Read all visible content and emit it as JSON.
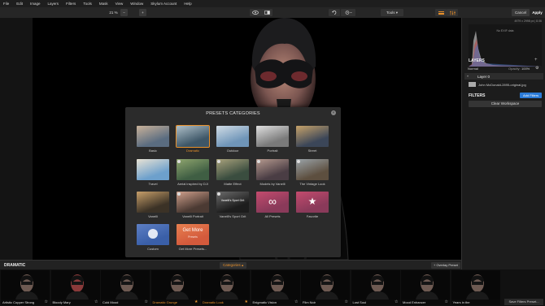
{
  "menu": [
    "File",
    "Edit",
    "Image",
    "Layers",
    "Filters",
    "Tools",
    "Mask",
    "View",
    "Window",
    "Skylum Account",
    "Help"
  ],
  "toolbar": {
    "zoom": "21 %",
    "minus": "−",
    "plus": "+",
    "tools": "Tools ▾",
    "cancel": "Cancel",
    "apply": "Apply"
  },
  "histogram": {
    "info": "4979 x 2998 px  |  8.06",
    "exif": "No EXIF data"
  },
  "layers": {
    "header": "LAYERS",
    "mode": "Normal",
    "opacity_label": "Opacity:",
    "opacity_value": "100%",
    "layer_name": "Layer 0",
    "file_name": "John McDonald-2895-original.jpg"
  },
  "filters": {
    "header": "FILTERS",
    "add_label": "Add Filters",
    "clear_label": "Clear Workspace"
  },
  "dialog": {
    "title": "PRESETS CATEGORIES",
    "close": "×",
    "tiles": [
      {
        "label": "Basic",
        "color1": "#5a6c80",
        "color2": "#c9b29a",
        "badge": false
      },
      {
        "label": "Dramatic",
        "color1": "#3d5667",
        "color2": "#aebfc8",
        "badge": false
      },
      {
        "label": "Outdoor",
        "color1": "#6f95b8",
        "color2": "#d2dde6",
        "badge": false
      },
      {
        "label": "Portrait",
        "color1": "#7a7a7a",
        "color2": "#e0e0e0",
        "badge": false
      },
      {
        "label": "Street",
        "color1": "#3b4658",
        "color2": "#c7a36a",
        "badge": false
      },
      {
        "label": "Travel",
        "color1": "#6da0cc",
        "color2": "#e8e2d4",
        "badge": false
      },
      {
        "label": "Aerial inspired by DJI",
        "color1": "#3f5e43",
        "color2": "#8fa56e",
        "badge": true
      },
      {
        "label": "Matte Effect",
        "color1": "#3a4d3f",
        "color2": "#a9a27c",
        "badge": true
      },
      {
        "label": "Models by Vanelli",
        "color1": "#4a3d44",
        "color2": "#b69a8f",
        "badge": true
      },
      {
        "label": "The Vintage Look",
        "color1": "#5d4f3f",
        "color2": "#9aa3a8",
        "badge": true
      },
      {
        "label": "Vanelli",
        "color1": "#3b3226",
        "color2": "#c79f6a",
        "badge": false
      },
      {
        "label": "Vanelli Portrait",
        "color1": "#4b3a33",
        "color2": "#cfa08c",
        "badge": true
      },
      {
        "label": "Vanelli's Sport Grit",
        "color1": "#1d1d1d",
        "color2": "#6b6b6b",
        "badge": true
      },
      {
        "label": "All Presets",
        "color1": "#8a3a5a",
        "color2": "#c44b6e",
        "badge": false
      },
      {
        "label": "Favorite",
        "color1": "#8a3a5a",
        "color2": "#c44b6e",
        "badge": false
      },
      {
        "label": "Custom",
        "color1": "#3a5fa8",
        "color2": "#5d7fc4",
        "badge": false
      },
      {
        "label": "Get More Presets...",
        "color1": "#d35a3c",
        "color2": "#e88050",
        "badge": false
      }
    ],
    "vanelli_sport_text": "Vanelli's Sport Grit",
    "get_more_text": "Get More",
    "get_more_sub": "Presets",
    "all_symbol": "∞",
    "fav_symbol": "★",
    "selected_index": 1
  },
  "bottom": {
    "category": "DRAMATIC",
    "categories_btn": "Categories ▴",
    "overlay_btn": "+ Overlay Preset",
    "save_btn": "Save Filters Preset...",
    "presets": [
      {
        "name": "Artistic Copper Strong",
        "active": false
      },
      {
        "name": "Bloody Mary",
        "active": false
      },
      {
        "name": "Cold Mood",
        "active": false
      },
      {
        "name": "Dramatic Grunge",
        "active": true
      },
      {
        "name": "Dramatic Look",
        "active": true
      },
      {
        "name": "Enigmatic Vision",
        "active": false
      },
      {
        "name": "Film Noir",
        "active": false
      },
      {
        "name": "Lost Soul",
        "active": false
      },
      {
        "name": "Mood Enhancer",
        "active": false
      },
      {
        "name": "Years in the",
        "active": false
      }
    ]
  },
  "colors": {
    "accent": "#e8902a",
    "blue": "#2b7bd8"
  }
}
